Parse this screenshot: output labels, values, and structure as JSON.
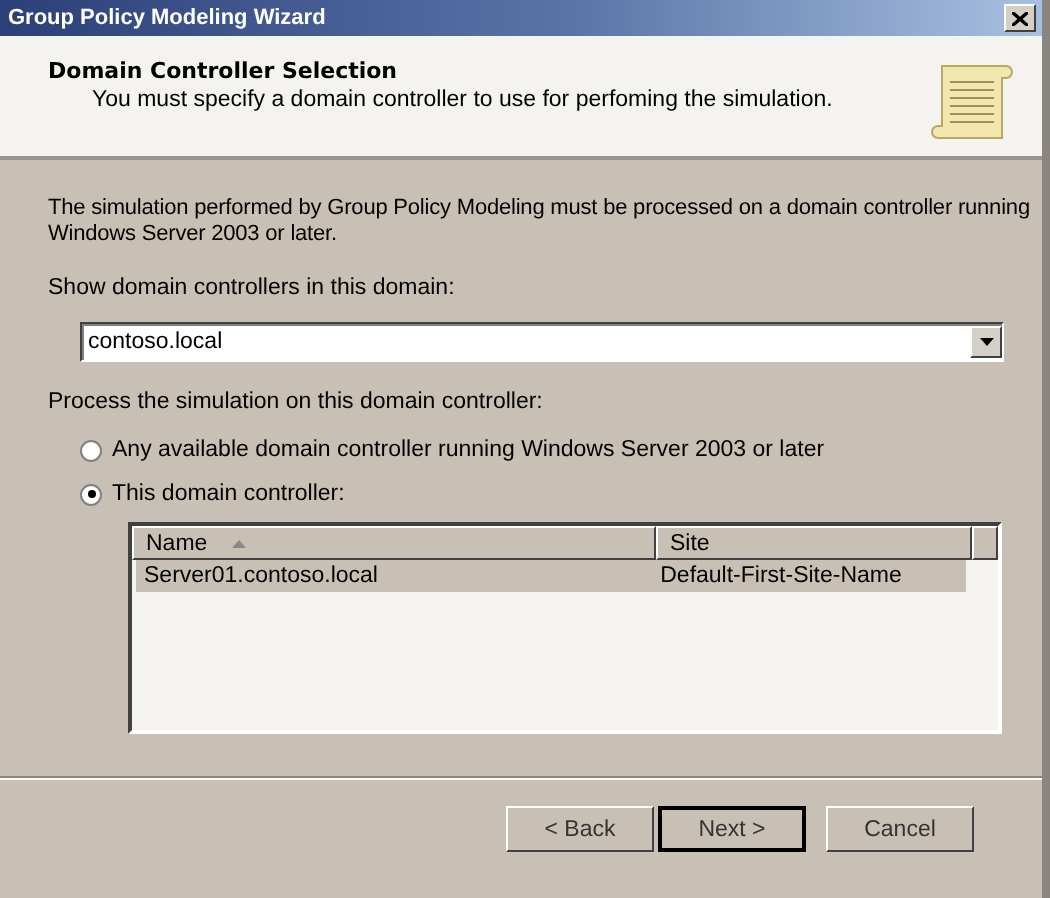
{
  "window": {
    "title": "Group Policy Modeling Wizard"
  },
  "header": {
    "title": "Domain Controller Selection",
    "subtitle": "You must specify a domain controller to use for perfoming the simulation."
  },
  "intro": "The simulation performed by Group Policy Modeling must be processed on a domain controller running Windows Server 2003 or later.",
  "domain": {
    "label": "Show domain controllers in this domain:",
    "value": "contoso.local"
  },
  "process": {
    "label": "Process the simulation on this domain controller:",
    "options": [
      {
        "label": "Any available domain controller running Windows Server 2003 or later",
        "selected": false
      },
      {
        "label": "This domain controller:",
        "selected": true
      }
    ]
  },
  "table": {
    "columns": [
      {
        "label": "Name",
        "sorted": true
      },
      {
        "label": "Site",
        "sorted": false
      }
    ],
    "rows": [
      {
        "cells": [
          "Server01.contoso.local",
          "Default-First-Site-Name"
        ],
        "selected": true
      }
    ]
  },
  "buttons": [
    {
      "label": "< Back",
      "default": false
    },
    {
      "label": "Next >",
      "default": true
    },
    {
      "label": "Cancel",
      "default": false
    }
  ]
}
